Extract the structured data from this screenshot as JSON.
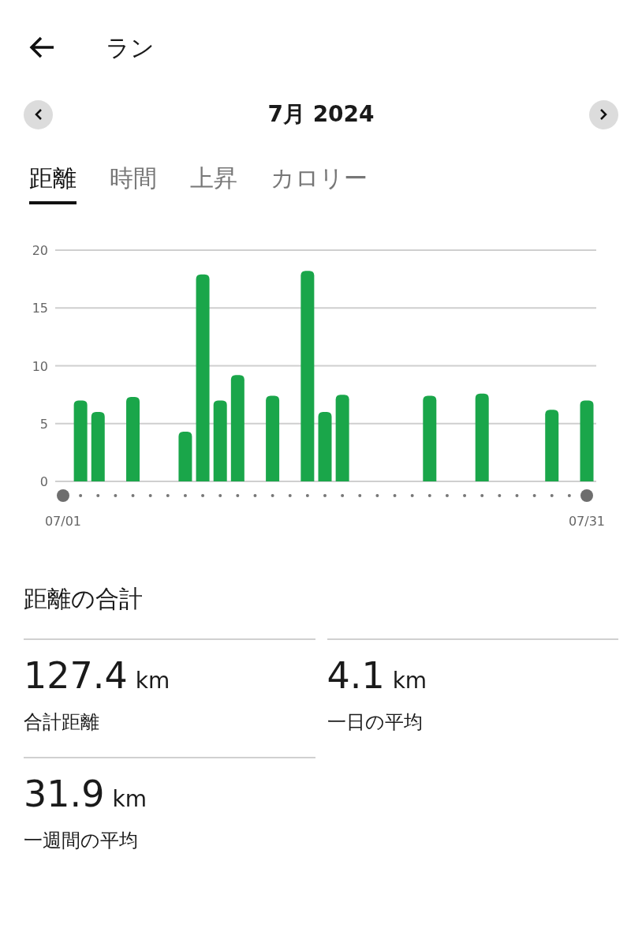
{
  "header": {
    "title": "ラン"
  },
  "period": {
    "label": "7月 2024"
  },
  "tabs": [
    {
      "label": "距離",
      "selected": true
    },
    {
      "label": "時間",
      "selected": false
    },
    {
      "label": "上昇",
      "selected": false
    },
    {
      "label": "カロリー",
      "selected": false
    }
  ],
  "chart_data": {
    "type": "bar",
    "categories": [
      "07/01",
      null,
      null,
      null,
      null,
      null,
      null,
      null,
      null,
      null,
      null,
      null,
      null,
      null,
      null,
      null,
      null,
      null,
      null,
      null,
      null,
      null,
      null,
      null,
      null,
      null,
      null,
      null,
      null,
      null,
      "07/31"
    ],
    "grid": true,
    "series": [
      {
        "color": "#1aa64a",
        "values": [
          null,
          7.0,
          6.0,
          null,
          7.3,
          null,
          null,
          4.3,
          17.9,
          7.0,
          9.2,
          null,
          7.4,
          null,
          18.2,
          6.0,
          7.5,
          null,
          null,
          null,
          null,
          7.4,
          null,
          null,
          7.6,
          null,
          null,
          null,
          6.2,
          null,
          7.0
        ]
      }
    ],
    "ylim": [
      0,
      20
    ],
    "yticks": [
      0,
      5,
      10,
      15,
      20
    ]
  },
  "summary": {
    "title": "距離の合計",
    "stats": [
      {
        "value": "127.4",
        "unit": "km",
        "label": "合計距離"
      },
      {
        "value": "4.1",
        "unit": "km",
        "label": "一日の平均"
      },
      {
        "value": "31.9",
        "unit": "km",
        "label": "一週間の平均"
      }
    ]
  }
}
